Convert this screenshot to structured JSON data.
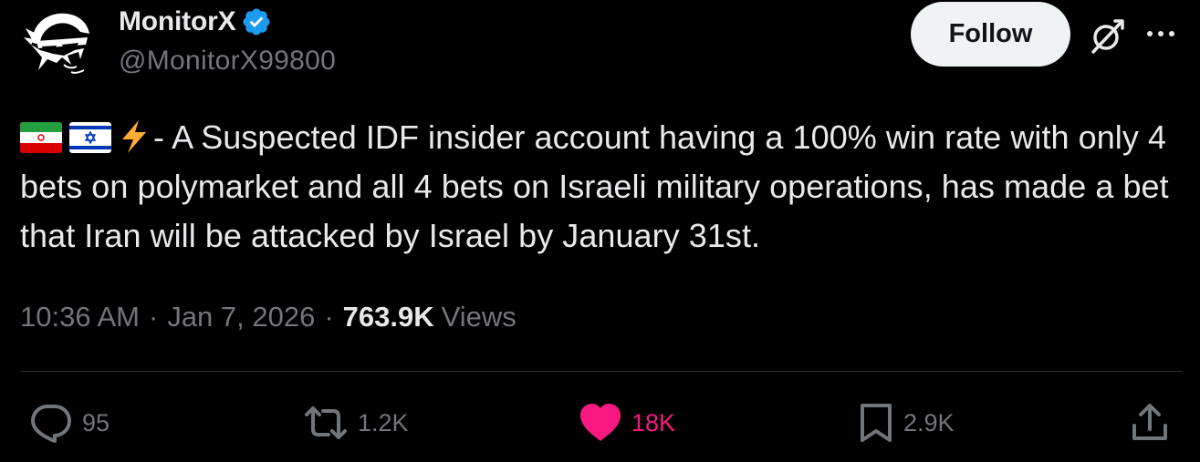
{
  "author": {
    "display_name": "MonitorX",
    "handle": "@MonitorX99800",
    "verified": true,
    "avatar_icon": "ninja-mask-avatar"
  },
  "header": {
    "follow_label": "Follow",
    "grok_icon": "grok-icon",
    "more_icon": "more-horizontal-icon"
  },
  "tweet": {
    "flags": [
      "iran-flag",
      "israel-flag"
    ],
    "emoji": "lightning-bolt",
    "text": "- A Suspected IDF insider account having a 100% win rate with only 4 bets on polymarket and all 4 bets on Israeli military operations, has made a bet that Iran will be attacked by Israel by January 31st."
  },
  "meta": {
    "time": "10:36 AM",
    "date": "Jan 7, 2026",
    "separator": "·",
    "views_count": "763.9K",
    "views_label": "Views"
  },
  "actions": {
    "replies": "95",
    "reposts": "1.2K",
    "likes": "18K",
    "bookmarks": "2.9K"
  },
  "colors": {
    "background": "#000000",
    "text": "#e7e9ea",
    "muted": "#71767b",
    "verified_blue": "#1d9bf0",
    "like_pink": "#f91880",
    "divider": "#2f3336"
  }
}
